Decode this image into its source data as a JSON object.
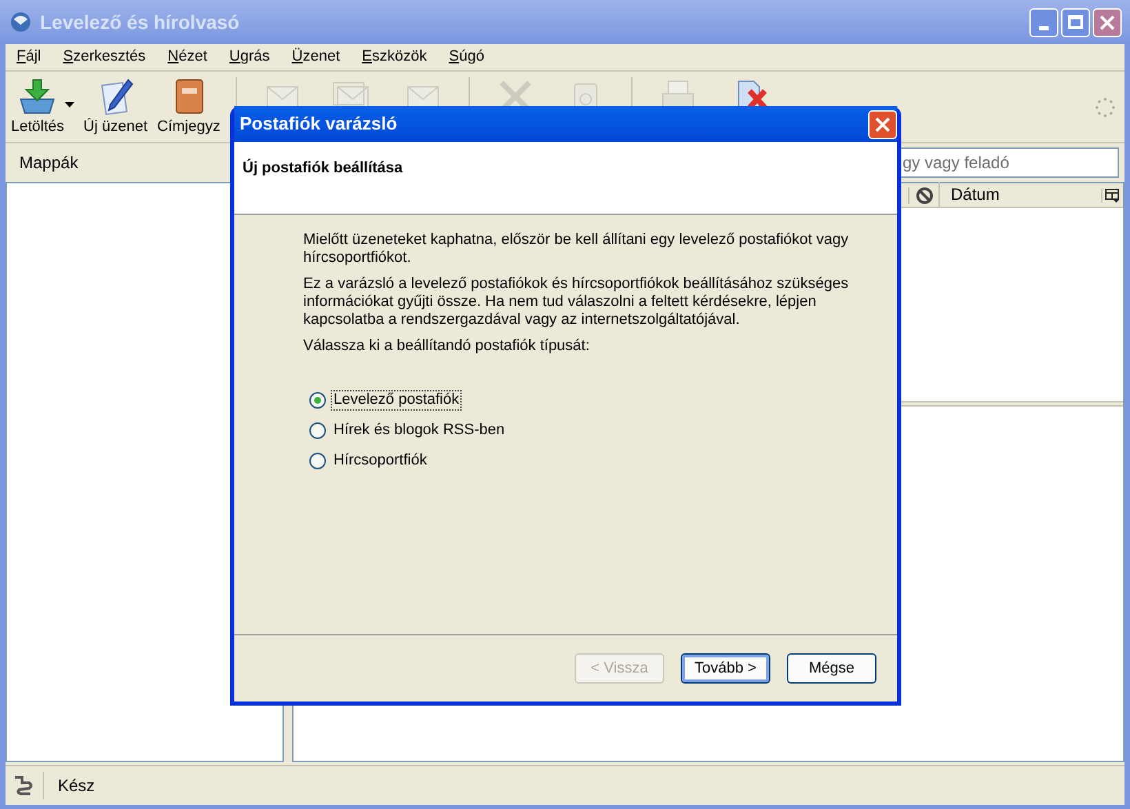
{
  "window": {
    "title": "Levelező és hírolvasó"
  },
  "menu": [
    "Fájl",
    "Szerkesztés",
    "Nézet",
    "Ugrás",
    "Üzenet",
    "Eszközök",
    "Súgó"
  ],
  "toolbar": [
    {
      "kind": "download",
      "label": "Letöltés",
      "dropdown": true,
      "disabled": false
    },
    {
      "kind": "compose",
      "label": "Új üzenet",
      "dropdown": false,
      "disabled": false
    },
    {
      "kind": "addressbook",
      "label": "Címjegyz",
      "dropdown": false,
      "disabled": false
    },
    {
      "kind": "separator"
    },
    {
      "kind": "reply",
      "disabled": true
    },
    {
      "kind": "replyall",
      "disabled": true
    },
    {
      "kind": "forward",
      "disabled": true
    },
    {
      "kind": "separator"
    },
    {
      "kind": "delete",
      "disabled": true
    },
    {
      "kind": "junk",
      "disabled": true
    },
    {
      "kind": "separator"
    },
    {
      "kind": "print",
      "disabled": true
    },
    {
      "kind": "stop",
      "disabled": false
    }
  ],
  "folder_pane": {
    "header": "Mappák"
  },
  "search": {
    "placeholder": "gy vagy feladó"
  },
  "columns": [
    {
      "kind": "junk"
    },
    {
      "kind": "text",
      "label": "Dátum"
    },
    {
      "kind": "picker"
    }
  ],
  "status_bar": {
    "text": "Kész"
  },
  "dialog": {
    "title": "Postafiók varázsló",
    "heading": "Új postafiók beállítása",
    "paragraphs": [
      "Mielőtt üzeneteket kaphatna, először be kell állítani egy levelező postafiókot vagy hírcsoportfiókot.",
      "Ez a varázsló a levelező postafiókok és hírcsoportfiókok beállításához szükséges információkat gyűjti össze. Ha nem tud válaszolni a feltett kérdésekre, lépjen kapcsolatba a rendszergazdával vagy az internetszolgáltatójával.",
      "Válassza ki a beállítandó postafiók típusát:"
    ],
    "options": [
      {
        "label": "Levelező postafiók",
        "selected": true
      },
      {
        "label": "Hírek és blogok RSS-ben",
        "selected": false
      },
      {
        "label": "Hírcsoportfiók",
        "selected": false
      }
    ],
    "buttons": [
      {
        "label": "< Vissza",
        "disabled": true,
        "default": false
      },
      {
        "label": "Tovább >",
        "disabled": false,
        "default": true
      },
      {
        "label": "Mégse",
        "disabled": false,
        "default": false
      }
    ]
  }
}
